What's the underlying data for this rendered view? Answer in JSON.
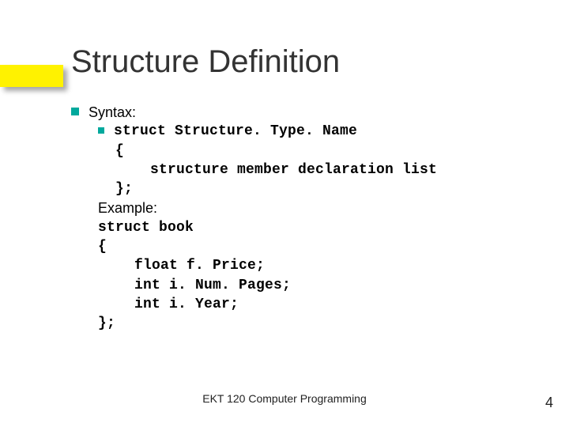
{
  "title": "Structure Definition",
  "body": {
    "syntax_label": "Syntax:",
    "syntax_line1": "struct Structure. Type. Name",
    "syntax_line2": "{",
    "syntax_line3": "structure member declaration list",
    "syntax_line4": "};",
    "example_label": "Example:",
    "ex_line1": "struct book",
    "ex_line2": "{",
    "ex_line3": "float f. Price;",
    "ex_line4": "int i. Num. Pages;",
    "ex_line5": "int i. Year;",
    "ex_line6": "};"
  },
  "footer": "EKT 120 Computer Programming",
  "page_number": "4"
}
